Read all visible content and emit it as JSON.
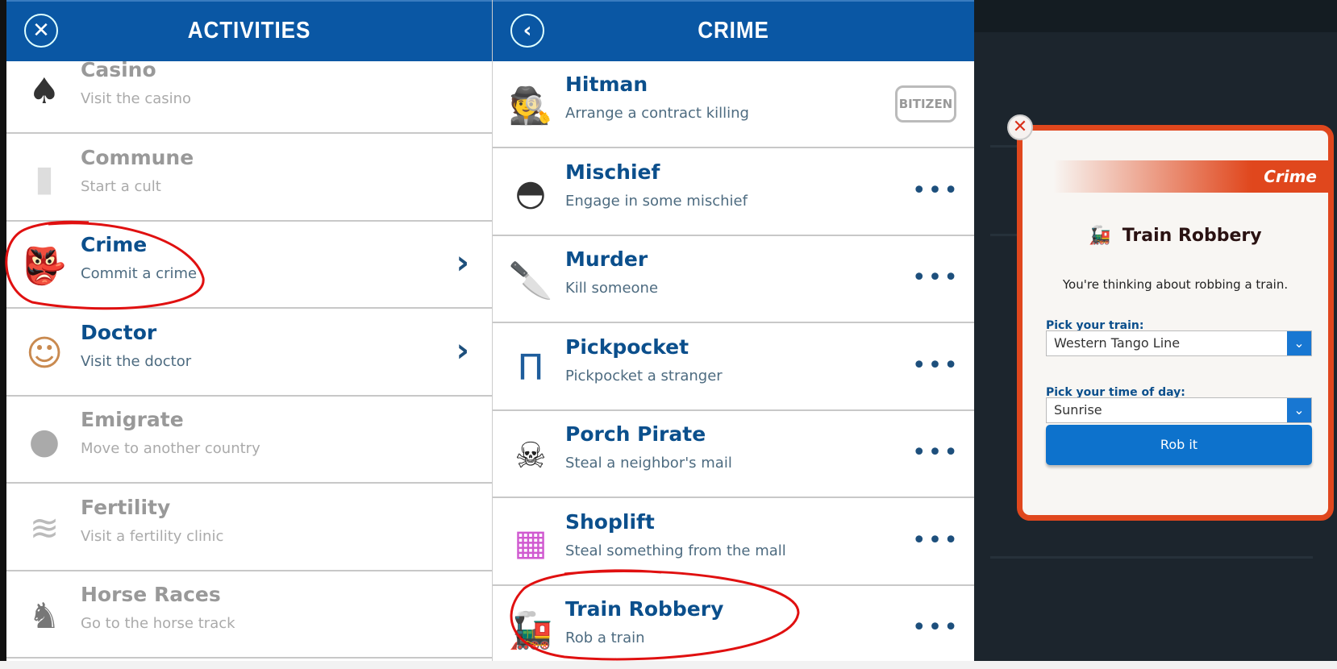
{
  "activities": {
    "title": "ACTIVITIES",
    "close_icon": "close-circle-icon",
    "items": [
      {
        "title": "Casino",
        "subtitle": "Visit the casino",
        "icon": "spade-icon",
        "enabled": false,
        "chevron": false
      },
      {
        "title": "Commune",
        "subtitle": "Start a cult",
        "icon": "candle-icon",
        "enabled": false,
        "chevron": false
      },
      {
        "title": "Crime",
        "subtitle": "Commit a crime",
        "icon": "tengu-mask-icon",
        "enabled": true,
        "chevron": true
      },
      {
        "title": "Doctor",
        "subtitle": "Visit the doctor",
        "icon": "doctor-icon",
        "enabled": true,
        "chevron": true
      },
      {
        "title": "Emigrate",
        "subtitle": "Move to another country",
        "icon": "globe-icon",
        "enabled": false,
        "chevron": false
      },
      {
        "title": "Fertility",
        "subtitle": "Visit a fertility clinic",
        "icon": "dna-icon",
        "enabled": false,
        "chevron": false
      },
      {
        "title": "Horse Races",
        "subtitle": "Go to the horse track",
        "icon": "horse-racing-icon",
        "enabled": false,
        "chevron": false
      }
    ]
  },
  "crime": {
    "title": "CRIME",
    "back_icon": "back-circle-icon",
    "items": [
      {
        "title": "Hitman",
        "subtitle": "Arrange a contract killing",
        "icon": "spy-icon",
        "badge": "BITIZEN"
      },
      {
        "title": "Mischief",
        "subtitle": "Engage in some mischief",
        "icon": "propeller-cap-icon",
        "more": "•••"
      },
      {
        "title": "Murder",
        "subtitle": "Kill someone",
        "icon": "knife-icon",
        "more": "•••"
      },
      {
        "title": "Pickpocket",
        "subtitle": "Pickpocket a stranger",
        "icon": "jeans-icon",
        "more": "•••"
      },
      {
        "title": "Porch Pirate",
        "subtitle": "Steal a neighbor's mail",
        "icon": "skull-crossbones-icon",
        "more": "•••"
      },
      {
        "title": "Shoplift",
        "subtitle": "Steal something from the mall",
        "icon": "shopping-bags-icon",
        "more": "•••"
      },
      {
        "title": "Train Robbery",
        "subtitle": "Rob a train",
        "icon": "train-icon",
        "more": "•••"
      }
    ]
  },
  "modal": {
    "category": "Crime",
    "title": "Train Robbery",
    "icon": "train-icon",
    "text": "You're thinking about robbing a train.",
    "train_label": "Pick your train:",
    "train_value": "Western Tango Line",
    "time_label": "Pick your time of day:",
    "time_value": "Sunrise",
    "button": "Rob it",
    "close": "✕"
  },
  "colors": {
    "header": "#0a57a4",
    "title_text": "#0b4f8c",
    "modal_border": "#e0471d",
    "button": "#0d72cc",
    "annotation": "#e01010"
  }
}
